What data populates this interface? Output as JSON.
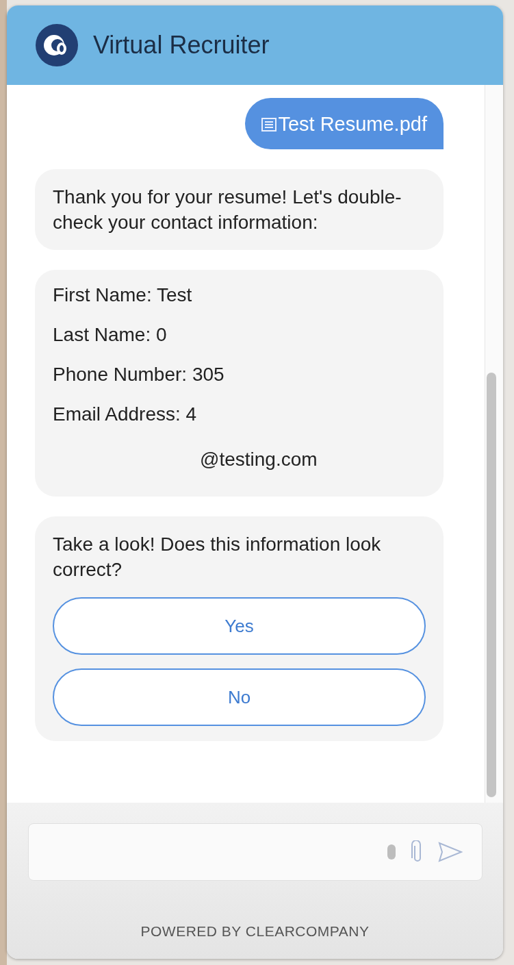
{
  "header": {
    "title": "Virtual Recruiter"
  },
  "messages": [
    {
      "kind": "file",
      "text": "Test Resume.pdf"
    },
    {
      "kind": "text",
      "text": "Thank you for your resume! Let's double-check your contact information:"
    },
    {
      "kind": "fields",
      "lines": [
        {
          "kind": "line",
          "text": "First Name: Test"
        },
        {
          "kind": "line",
          "text": "Last Name: 0"
        },
        {
          "kind": "line",
          "text": "Phone Number: 305"
        },
        {
          "kind": "line",
          "text": "Email Address: 4"
        },
        {
          "kind": "continuation",
          "text": "@testing.com"
        }
      ]
    },
    {
      "kind": "question",
      "text": "Take a look! Does this information look correct?",
      "options": [
        "Yes",
        "No"
      ]
    }
  ],
  "footer": {
    "powered_by": "POWERED BY CLEARCOMPANY"
  }
}
